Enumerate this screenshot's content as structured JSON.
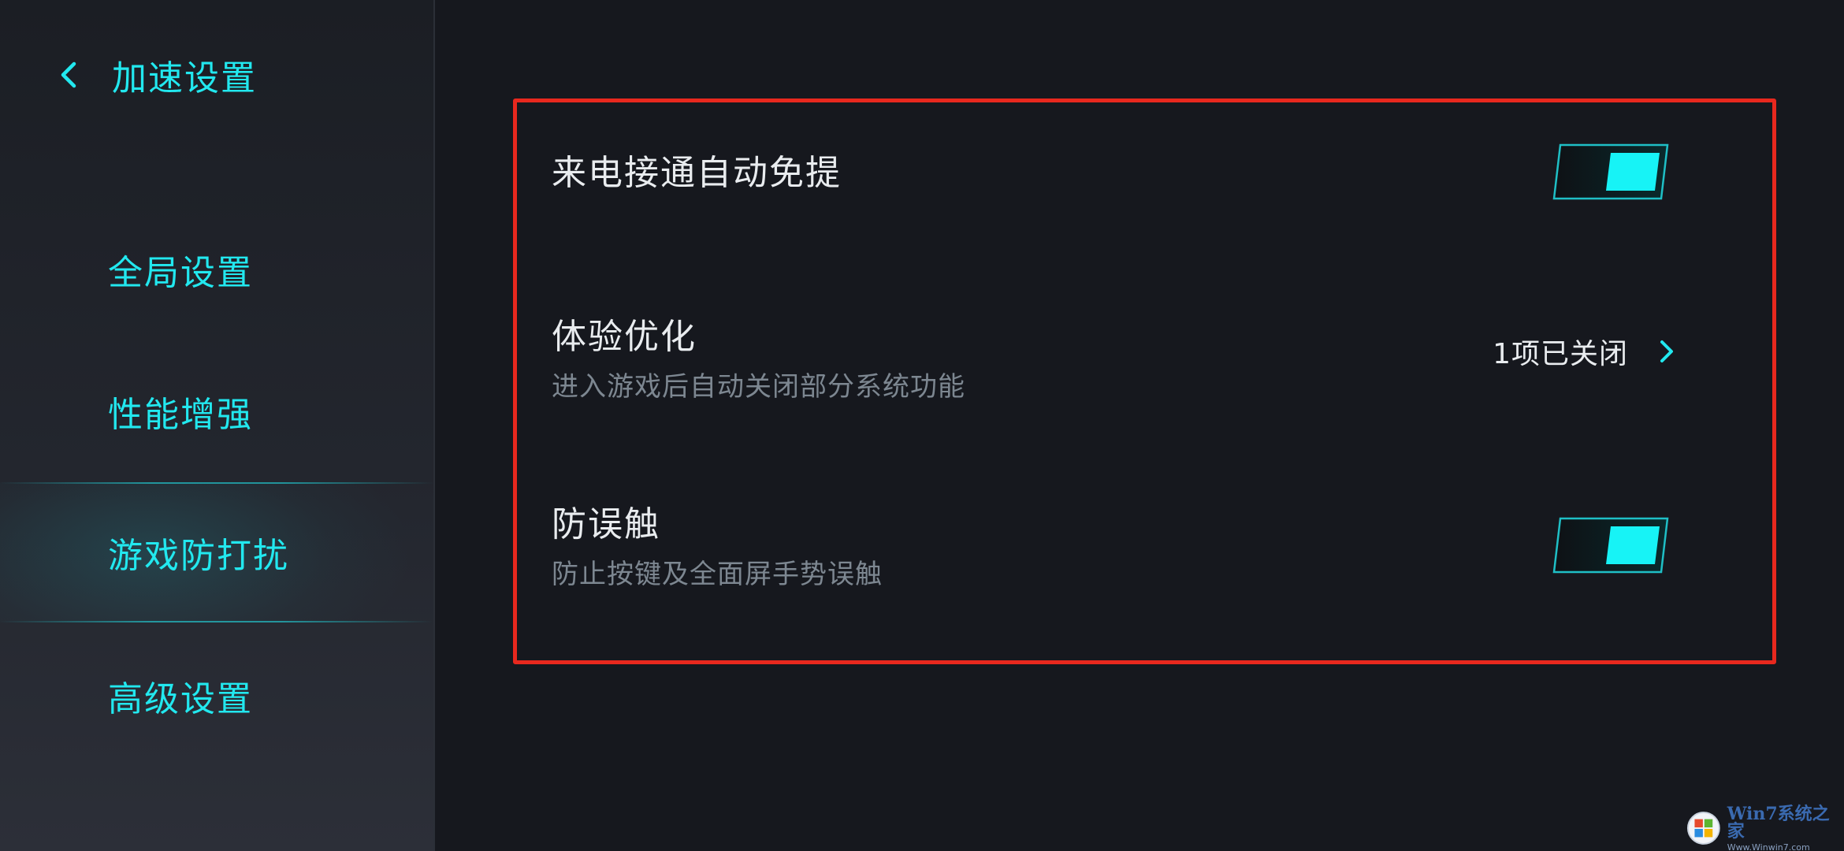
{
  "colors": {
    "accent": "#22e8ef",
    "background": "#16181e",
    "sidebar": "#1f2228",
    "highlight_frame": "#e8281e",
    "primary_text": "#e9ecef",
    "secondary_text": "#7d8791"
  },
  "header": {
    "back_icon": "chevron-left-icon",
    "title": "加速设置"
  },
  "sidebar": {
    "items": [
      {
        "label": "全局设置",
        "active": false
      },
      {
        "label": "性能增强",
        "active": false
      },
      {
        "label": "游戏防打扰",
        "active": true
      },
      {
        "label": "高级设置",
        "active": false
      }
    ]
  },
  "settings": {
    "auto_answer": {
      "title": "来电接通自动免提",
      "enabled": true
    },
    "experience": {
      "title": "体验优化",
      "subtitle": "进入游戏后自动关闭部分系统功能",
      "value": "1项已关闭",
      "icon": "chevron-right-icon"
    },
    "anti_mistouch": {
      "title": "防误触",
      "subtitle": "防止按键及全面屏手势误触",
      "enabled": true
    }
  },
  "watermark": {
    "line1": "Win7系统之家",
    "line2": "Www.Winwin7.com"
  }
}
